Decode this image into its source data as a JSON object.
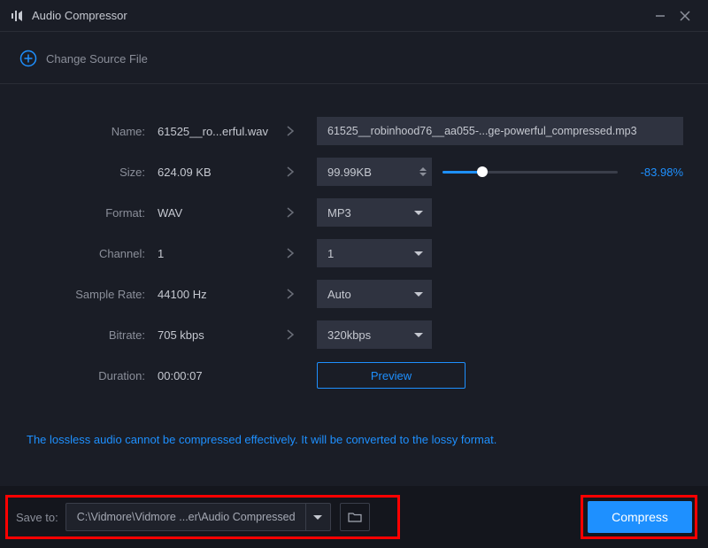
{
  "title": "Audio Compressor",
  "change_source": "Change Source File",
  "labels": {
    "name": "Name:",
    "size": "Size:",
    "format": "Format:",
    "channel": "Channel:",
    "sample_rate": "Sample Rate:",
    "bitrate": "Bitrate:",
    "duration": "Duration:"
  },
  "source": {
    "name": "61525__ro...erful.wav",
    "size": "624.09 KB",
    "format": "WAV",
    "channel": "1",
    "sample_rate": "44100 Hz",
    "bitrate": "705 kbps",
    "duration": "00:00:07"
  },
  "target": {
    "filename": "61525__robinhood76__aa055-...ge-powerful_compressed.mp3",
    "size": "99.99KB",
    "percent": "-83.98%",
    "format": "MP3",
    "channel": "1",
    "sample_rate": "Auto",
    "bitrate": "320kbps"
  },
  "preview": "Preview",
  "warning": "The lossless audio cannot be compressed effectively. It will be converted to the lossy format.",
  "footer": {
    "save_to_label": "Save to:",
    "path": "C:\\Vidmore\\Vidmore ...er\\Audio Compressed",
    "compress": "Compress"
  }
}
